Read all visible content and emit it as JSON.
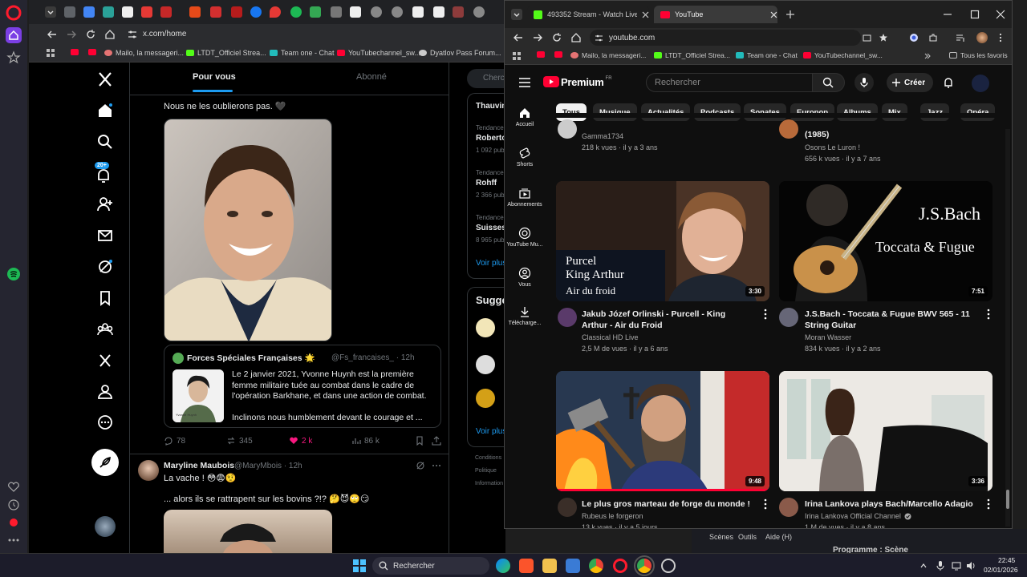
{
  "back_window": {
    "tab_title": "",
    "url": "x.com/home",
    "bookmarks": [
      "Mailo, la messageri...",
      "LTDT_Officiel Strea...",
      "Team one - Chat",
      "YouTubechannel_sw...",
      "Dyatlov Pass Forum..."
    ],
    "feed_tabs": [
      "Pour vous",
      "Abonné"
    ],
    "notif_badge": "20+",
    "post1_text": "Nous ne les oublierons pas. 🖤",
    "quote": {
      "author": "Forces Spéciales Françaises 🌟",
      "handle": "@Fs_francaises_ · 12h",
      "text": "Le 2 janvier 2021, Yvonne Huynh est la première femme militaire tuée au combat dans le cadre de l'opération Barkhane, et dans une action de combat.",
      "text2": "Inclinons nous humblement devant le courage et ...",
      "image_caption": "Yvonne Huynh"
    },
    "post1_stats": {
      "replies": "78",
      "reposts": "345",
      "likes": "2 k",
      "views": "86 k"
    },
    "post2": {
      "author": "Maryline Maubois",
      "handle": "@MaryMbois · 12h",
      "line1": "La vache ! 😳😨🤨",
      "line2": "... alors ils se rattrapent sur les bovins ?!? 🤔😈🙄😏"
    },
    "trends": [
      {
        "label": "Tendance",
        "name": "Thauvin",
        "count": ""
      },
      {
        "label": "Tendance",
        "name": "Roberto",
        "count": "1 092 pub"
      },
      {
        "label": "Tendance",
        "name": "Rohff",
        "count": "2 366 pub"
      },
      {
        "label": "Tendance",
        "name": "Suisses",
        "count": "8 965 pub"
      }
    ],
    "see_more": "Voir plus",
    "suggest_title": "Sugge",
    "search_placeholder": "Cherc",
    "footer": [
      "Conditions",
      "Politique",
      "Information"
    ],
    "colors": {
      "accent": "#1d9bf0",
      "like": "#f91880"
    }
  },
  "front_window": {
    "tabs": [
      {
        "title": "493352 Stream - Watch Live on",
        "icon": "kick-icon"
      },
      {
        "title": "YouTube",
        "icon": "youtube-icon"
      }
    ],
    "url": "youtube.com",
    "bookmarks": [
      "Mailo, la messageri...",
      "LTDT_Officiel Strea...",
      "Team one - Chat",
      "YouTubechannel_sw..."
    ],
    "all_bookmarks": "Tous les favoris",
    "yt": {
      "logo": "Premium",
      "logo_region": "FR",
      "search_placeholder": "Rechercher",
      "create_label": "Créer",
      "chips": [
        "Tous",
        "Musique",
        "Actualités",
        "Podcasts",
        "Sonates",
        "Europop",
        "Albums",
        "Mix",
        "Jazz",
        "Opéra"
      ],
      "sidebar": [
        "Accueil",
        "Shorts",
        "Abonnements",
        "YouTube Mu...",
        "Vous",
        "Télécharge..."
      ],
      "top_partial": [
        {
          "channel": "Gamma1734",
          "meta": "218 k vues · il y a 3 ans"
        },
        {
          "title": "(1985)",
          "channel": "Osons Le Luron !",
          "meta": "656 k vues · il y a 7 ans"
        }
      ],
      "videos": [
        {
          "title": "Jakub Józef Orlinski - Purcell - King Arthur - Air du Froid",
          "channel": "Classical HD Live",
          "meta": "2,5 M de vues · il y a 6 ans",
          "duration": "3:30",
          "overlay": [
            "Purcel",
            "King Arthur",
            "Air du froid"
          ]
        },
        {
          "title": "J.S.Bach - Toccata & Fugue BWV 565 - 11 String Guitar",
          "channel": "Moran Wasser",
          "meta": "834 k vues · il y a 2 ans",
          "duration": "7:51",
          "overlay": [
            "J.S.Bach",
            "Toccata & Fugue"
          ]
        },
        {
          "title": "Le plus gros marteau de forge du monde !",
          "channel": "Rubeus le forgeron",
          "meta": "13 k vues · il y a 5 jours",
          "duration": "9:48"
        },
        {
          "title": "Irina Lankova plays Bach/Marcello Adagio",
          "channel": "Irina Lankova Official Channel",
          "meta": "1 M de vues · il y a 8 ans",
          "duration": "3:36"
        }
      ],
      "colors": {
        "red": "#ff0033"
      }
    }
  },
  "behind_text": {
    "menu": [
      "Scènes",
      "Outils",
      "Aide (H)"
    ],
    "heading": "Programme : Scène"
  },
  "taskbar": {
    "search_label": "Rechercher",
    "time": "22:45",
    "date": "02/01/2026"
  }
}
